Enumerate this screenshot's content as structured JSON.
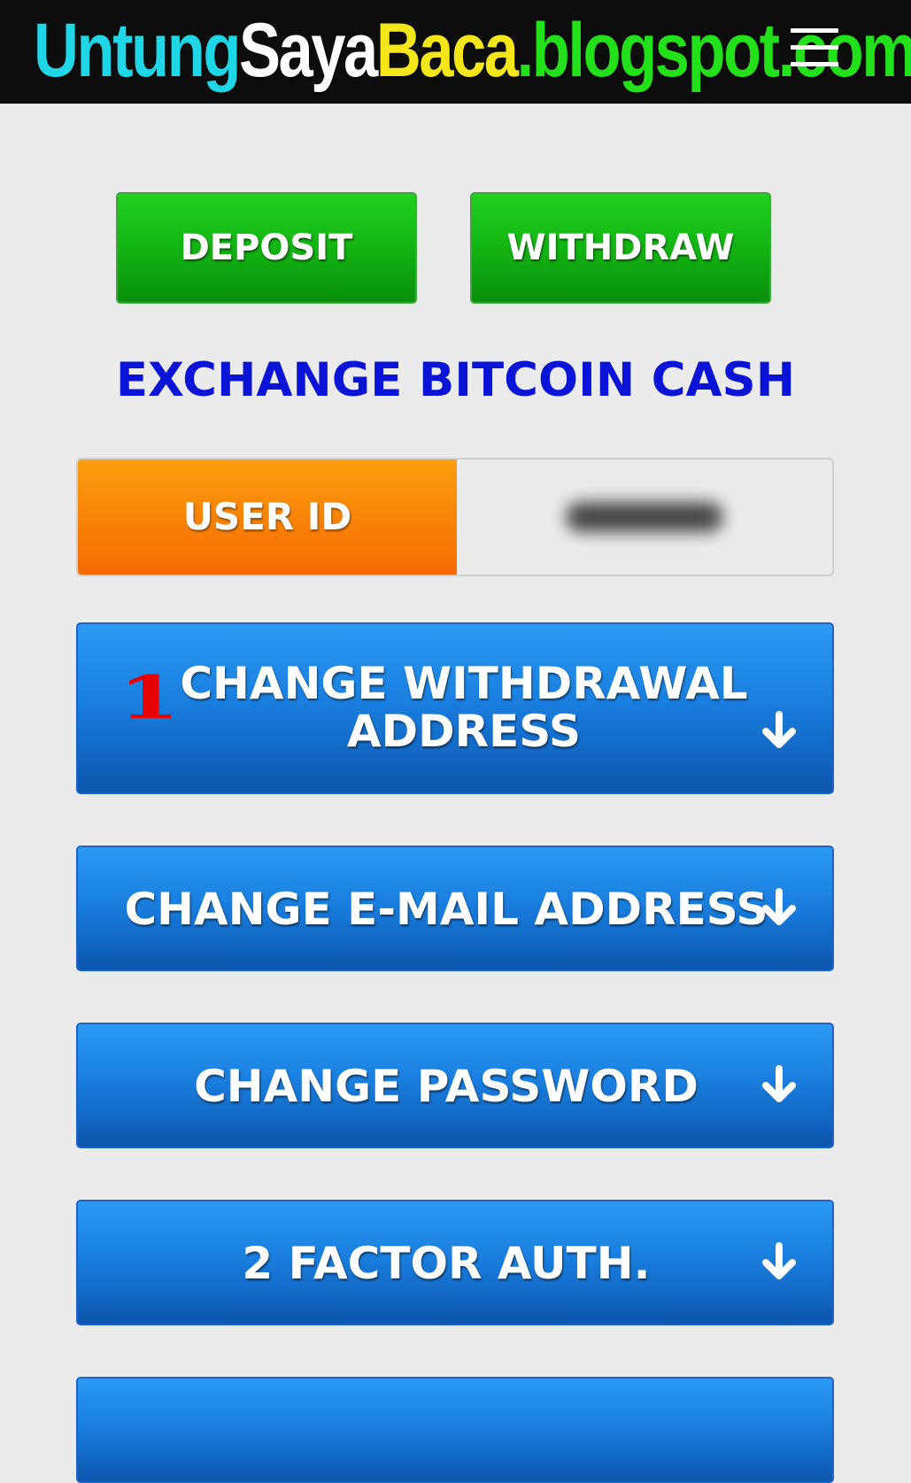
{
  "header": {
    "logo_parts": [
      {
        "text": "Untung",
        "color": "#1fd6e6"
      },
      {
        "text": "Saya",
        "color": "#ffffff"
      },
      {
        "text": "Baca",
        "color": "#f5e61a"
      },
      {
        "text": ".blogspot.com",
        "color": "#22e01a"
      }
    ],
    "menu_icon": "hamburger-menu-icon"
  },
  "actions": {
    "deposit_label": "DEPOSIT",
    "withdraw_label": "WITHDRAW"
  },
  "page_title": "EXCHANGE BITCOIN CASH",
  "user": {
    "id_label": "USER ID",
    "id_value_blurred": true
  },
  "settings": {
    "step_number": "1",
    "withdrawal_line1": "CHANGE WITHDRAWAL",
    "withdrawal_line2": "ADDRESS",
    "email_label": "CHANGE E-MAIL ADDRESS",
    "password_label": "CHANGE PASSWORD",
    "twofa_label": "2 FACTOR AUTH.",
    "expand_icon": "arrow-down-icon"
  },
  "colors": {
    "green_button": "#14b814",
    "blue_button": "#1a7fe0",
    "orange_label": "#f98208",
    "title_blue": "#0a14d6",
    "step_red": "#e60000"
  }
}
